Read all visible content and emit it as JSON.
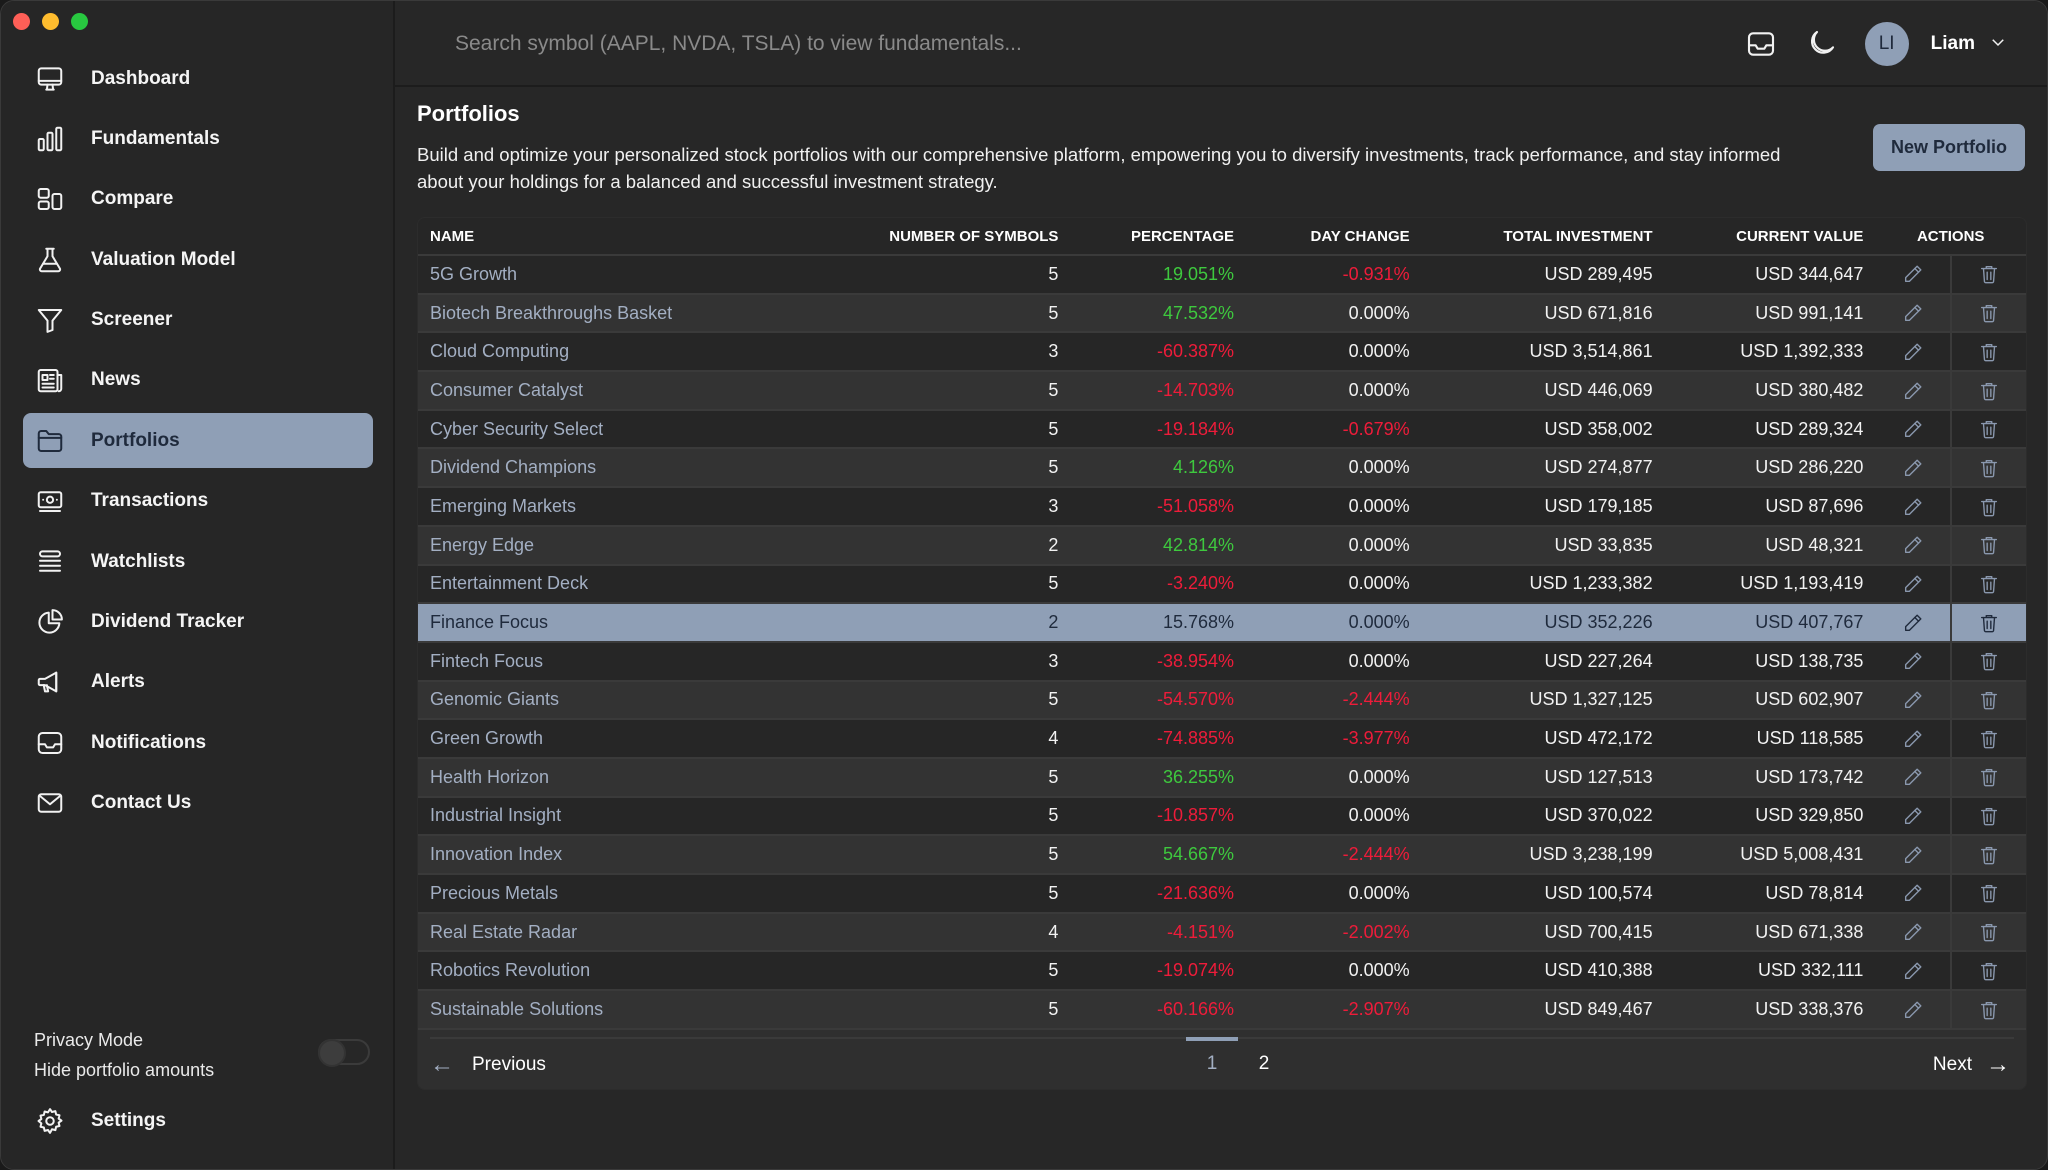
{
  "sidebar": {
    "items": [
      {
        "label": "Dashboard",
        "icon": "monitor-icon"
      },
      {
        "label": "Fundamentals",
        "icon": "bar-chart-icon"
      },
      {
        "label": "Compare",
        "icon": "compare-icon"
      },
      {
        "label": "Valuation Model",
        "icon": "flask-icon"
      },
      {
        "label": "Screener",
        "icon": "funnel-icon"
      },
      {
        "label": "News",
        "icon": "newspaper-icon"
      },
      {
        "label": "Portfolios",
        "icon": "folder-icon",
        "active": true
      },
      {
        "label": "Transactions",
        "icon": "cash-icon"
      },
      {
        "label": "Watchlists",
        "icon": "list-icon"
      },
      {
        "label": "Dividend Tracker",
        "icon": "pie-chart-icon"
      },
      {
        "label": "Alerts",
        "icon": "megaphone-icon"
      },
      {
        "label": "Notifications",
        "icon": "inbox-icon"
      },
      {
        "label": "Contact Us",
        "icon": "envelope-icon"
      }
    ],
    "privacy": {
      "title": "Privacy Mode",
      "subtitle": "Hide portfolio amounts",
      "enabled": false
    },
    "settings_label": "Settings"
  },
  "topbar": {
    "search_placeholder": "Search symbol (AAPL, NVDA, TSLA) to view fundamentals...",
    "avatar_initials": "LI",
    "username": "Liam"
  },
  "page": {
    "title": "Portfolios",
    "description": "Build and optimize your personalized stock portfolios with our comprehensive platform, empowering you to diversify investments, track performance, and stay informed about your holdings for a balanced and successful investment strategy.",
    "new_button": "New Portfolio"
  },
  "table": {
    "columns": [
      "Name",
      "Number of Symbols",
      "Percentage",
      "Day Change",
      "Total Investment",
      "Current Value",
      "Actions"
    ],
    "rows": [
      {
        "name": "5G Growth",
        "symbols": "5",
        "percentage": "19.051%",
        "pct_dir": "pos",
        "day_change": "-0.931%",
        "day_dir": "neg",
        "total": "USD 289,495",
        "current": "USD 344,647"
      },
      {
        "name": "Biotech Breakthroughs Basket",
        "symbols": "5",
        "percentage": "47.532%",
        "pct_dir": "pos",
        "day_change": "0.000%",
        "day_dir": "neu",
        "total": "USD 671,816",
        "current": "USD 991,141"
      },
      {
        "name": "Cloud Computing",
        "symbols": "3",
        "percentage": "-60.387%",
        "pct_dir": "neg",
        "day_change": "0.000%",
        "day_dir": "neu",
        "total": "USD 3,514,861",
        "current": "USD 1,392,333"
      },
      {
        "name": "Consumer Catalyst",
        "symbols": "5",
        "percentage": "-14.703%",
        "pct_dir": "neg",
        "day_change": "0.000%",
        "day_dir": "neu",
        "total": "USD 446,069",
        "current": "USD 380,482"
      },
      {
        "name": "Cyber Security Select",
        "symbols": "5",
        "percentage": "-19.184%",
        "pct_dir": "neg",
        "day_change": "-0.679%",
        "day_dir": "neg",
        "total": "USD 358,002",
        "current": "USD 289,324"
      },
      {
        "name": "Dividend Champions",
        "symbols": "5",
        "percentage": "4.126%",
        "pct_dir": "pos",
        "day_change": "0.000%",
        "day_dir": "neu",
        "total": "USD 274,877",
        "current": "USD 286,220"
      },
      {
        "name": "Emerging Markets",
        "symbols": "3",
        "percentage": "-51.058%",
        "pct_dir": "neg",
        "day_change": "0.000%",
        "day_dir": "neu",
        "total": "USD 179,185",
        "current": "USD 87,696"
      },
      {
        "name": "Energy Edge",
        "symbols": "2",
        "percentage": "42.814%",
        "pct_dir": "pos",
        "day_change": "0.000%",
        "day_dir": "neu",
        "total": "USD 33,835",
        "current": "USD 48,321"
      },
      {
        "name": "Entertainment Deck",
        "symbols": "5",
        "percentage": "-3.240%",
        "pct_dir": "neg",
        "day_change": "0.000%",
        "day_dir": "neu",
        "total": "USD 1,233,382",
        "current": "USD 1,193,419"
      },
      {
        "name": "Finance Focus",
        "symbols": "2",
        "percentage": "15.768%",
        "pct_dir": "pos",
        "day_change": "0.000%",
        "day_dir": "neu",
        "total": "USD 352,226",
        "current": "USD 407,767",
        "selected": true
      },
      {
        "name": "Fintech Focus",
        "symbols": "3",
        "percentage": "-38.954%",
        "pct_dir": "neg",
        "day_change": "0.000%",
        "day_dir": "neu",
        "total": "USD 227,264",
        "current": "USD 138,735"
      },
      {
        "name": "Genomic Giants",
        "symbols": "5",
        "percentage": "-54.570%",
        "pct_dir": "neg",
        "day_change": "-2.444%",
        "day_dir": "neg",
        "total": "USD 1,327,125",
        "current": "USD 602,907"
      },
      {
        "name": "Green Growth",
        "symbols": "4",
        "percentage": "-74.885%",
        "pct_dir": "neg",
        "day_change": "-3.977%",
        "day_dir": "neg",
        "total": "USD 472,172",
        "current": "USD 118,585"
      },
      {
        "name": "Health Horizon",
        "symbols": "5",
        "percentage": "36.255%",
        "pct_dir": "pos",
        "day_change": "0.000%",
        "day_dir": "neu",
        "total": "USD 127,513",
        "current": "USD 173,742"
      },
      {
        "name": "Industrial Insight",
        "symbols": "5",
        "percentage": "-10.857%",
        "pct_dir": "neg",
        "day_change": "0.000%",
        "day_dir": "neu",
        "total": "USD 370,022",
        "current": "USD 329,850"
      },
      {
        "name": "Innovation Index",
        "symbols": "5",
        "percentage": "54.667%",
        "pct_dir": "pos",
        "day_change": "-2.444%",
        "day_dir": "neg",
        "total": "USD 3,238,199",
        "current": "USD 5,008,431"
      },
      {
        "name": "Precious Metals",
        "symbols": "5",
        "percentage": "-21.636%",
        "pct_dir": "neg",
        "day_change": "0.000%",
        "day_dir": "neu",
        "total": "USD 100,574",
        "current": "USD 78,814"
      },
      {
        "name": "Real Estate Radar",
        "symbols": "4",
        "percentage": "-4.151%",
        "pct_dir": "neg",
        "day_change": "-2.002%",
        "day_dir": "neg",
        "total": "USD 700,415",
        "current": "USD 671,338"
      },
      {
        "name": "Robotics Revolution",
        "symbols": "5",
        "percentage": "-19.074%",
        "pct_dir": "neg",
        "day_change": "0.000%",
        "day_dir": "neu",
        "total": "USD 410,388",
        "current": "USD 332,111"
      },
      {
        "name": "Sustainable Solutions",
        "symbols": "5",
        "percentage": "-60.166%",
        "pct_dir": "neg",
        "day_change": "-2.907%",
        "day_dir": "neg",
        "total": "USD 849,467",
        "current": "USD 338,376"
      }
    ]
  },
  "pagination": {
    "previous_label": "Previous",
    "next_label": "Next",
    "pages": [
      "1",
      "2"
    ],
    "current_page": "1"
  },
  "colors": {
    "accent": "#8f9fb6",
    "positive": "#3ec93e",
    "negative": "#ee1c3a",
    "background": "#272727"
  }
}
